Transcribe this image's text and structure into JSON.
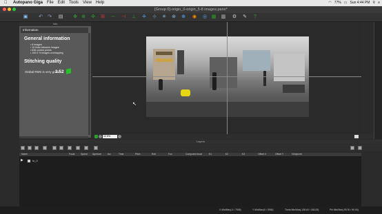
{
  "menubar": {
    "app_name": "Autopano Giga",
    "items": [
      "File",
      "Edit",
      "Tools",
      "View",
      "Help"
    ],
    "status": {
      "battery": "77%",
      "clock": "Sun 4:44 PM"
    }
  },
  "window": {
    "title": "[Group 0]-origin_0-origin_5-8 images.pano*"
  },
  "info_panel": {
    "header": "Info",
    "tab": "Information",
    "general_title": "General information",
    "general_items": [
      "• 8 images",
      "• 15 links between images",
      "• 638 control points",
      "• 100.0 % images overlapping"
    ],
    "stitching_title": "Stitching quality",
    "stitching_text": "Global RMS is very good :",
    "stitching_value": "3.52"
  },
  "zoom": {
    "value": "12.5%"
  },
  "layers": {
    "header": "Layers",
    "columns": [
      "Name",
      "Focal",
      "Speed",
      "Aperture",
      "Iso",
      "Time",
      "Pitch",
      "Roll",
      "Fov",
      "Computed focal",
      "K1",
      "K2",
      "K3",
      "Offset X",
      "Offset Y",
      "Viewpoint"
    ],
    "rows": [
      {
        "name": "lo_0"
      }
    ]
  },
  "status_bar": {
    "x": "X Min/Max(-0 / 7908)",
    "y": "Y Min/Max(0 / 3954)",
    "theta": "Theta Min/Max(-180.00 / 180.00)",
    "phi": "Phi Min/Max(-90.00 / 90.00)"
  },
  "colors": {
    "quality_indicator": "#26c22a",
    "toolbar_accent": "#2ca02c",
    "close_dot": "#ff5f57",
    "minimize_dot": "#febc2e",
    "zoom_dot": "#28c840"
  }
}
